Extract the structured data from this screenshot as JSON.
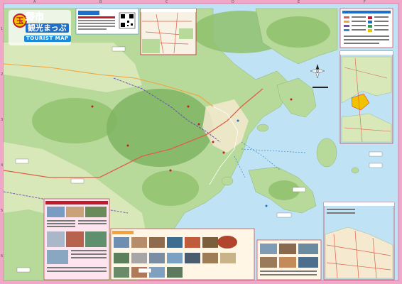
{
  "title": {
    "badge": "玉",
    "line1": "野市",
    "line2": "観光まっぷ",
    "line3": "TOURIST MAP"
  },
  "grid": {
    "columns": [
      "A",
      "B",
      "C",
      "D",
      "E",
      "F"
    ],
    "rows": [
      "1",
      "2",
      "3",
      "4",
      "5",
      "6"
    ]
  },
  "colors": {
    "sea": "#bfe3f4",
    "land": "#b7d99a",
    "hills": "#7fb462",
    "urban": "#f5e9cf",
    "border": "#f0a7c8",
    "title_blue": "#1f6ec7",
    "title_red": "#c01a2b"
  },
  "icons": [
    "north-arrow-icon",
    "qr-code-icon",
    "compass-rose-icon"
  ]
}
